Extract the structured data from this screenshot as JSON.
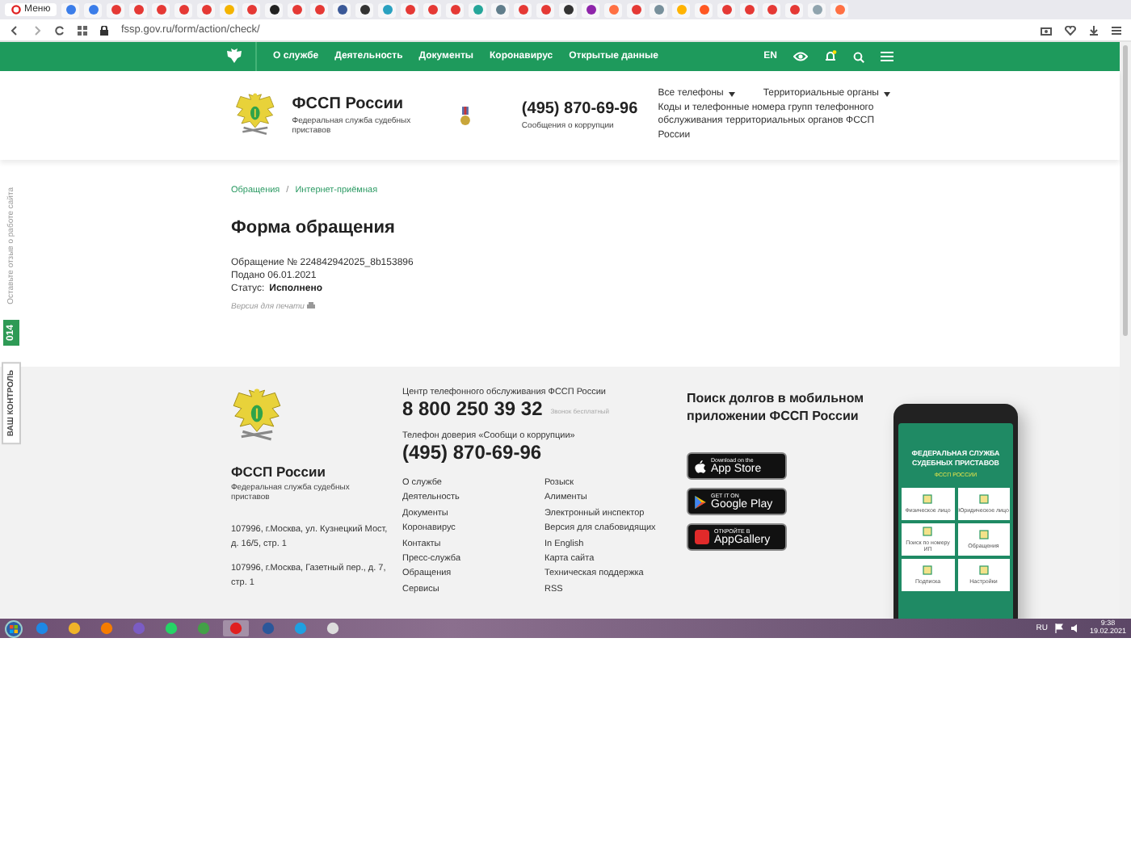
{
  "browser": {
    "menu_label": "Меню",
    "tabs": [
      {
        "color": "#3b7de9"
      },
      {
        "color": "#3b7de9"
      },
      {
        "color": "#e53935"
      },
      {
        "color": "#e53935"
      },
      {
        "color": "#e53935"
      },
      {
        "color": "#e53935"
      },
      {
        "color": "#e53935"
      },
      {
        "color": "#f4b400"
      },
      {
        "color": "#e53935"
      },
      {
        "color": "#222222"
      },
      {
        "color": "#e53935"
      },
      {
        "color": "#e53935"
      },
      {
        "color": "#3b5998"
      },
      {
        "color": "#333333"
      },
      {
        "color": "#2aa1c0"
      },
      {
        "color": "#e53935"
      },
      {
        "color": "#e53935"
      },
      {
        "color": "#e53935"
      },
      {
        "color": "#26a69a"
      },
      {
        "color": "#607d8b"
      },
      {
        "color": "#e53935"
      },
      {
        "color": "#e53935"
      },
      {
        "color": "#333333"
      },
      {
        "color": "#8e24aa"
      },
      {
        "color": "#ff7043"
      },
      {
        "color": "#e53935"
      },
      {
        "color": "#78909c"
      },
      {
        "color": "#ffb300"
      },
      {
        "color": "#ff5722"
      },
      {
        "color": "#e53935"
      },
      {
        "color": "#e53935"
      },
      {
        "color": "#e53935"
      },
      {
        "color": "#e53935"
      },
      {
        "color": "#90a4ae"
      },
      {
        "color": "#ff7043"
      }
    ],
    "url": "fssp.gov.ru/form/action/check/"
  },
  "nav": {
    "items": [
      "О службе",
      "Деятельность",
      "Документы",
      "Коронавирус",
      "Открытые данные"
    ],
    "lang": "EN"
  },
  "header": {
    "org_name": "ФССП России",
    "org_subtitle": "Федеральная служба судебных приставов",
    "phone": "(495) 870-69-96",
    "phone_caption": "Сообщения о коррупции",
    "links": [
      "Все телефоны",
      "Территориальные органы"
    ],
    "note": "Коды и телефонные номера групп телефонного обслуживания территориальных органов ФССП России"
  },
  "breadcrumbs": [
    "Обращения",
    "Интернет-приёмная"
  ],
  "breadcrumb_separator": "/",
  "page_title": "Форма обращения",
  "details": {
    "number": "Обращение № 224842942025_8b153896",
    "submitted": "Подано 06.01.2021",
    "status_label": "Статус:",
    "status_value": "Исполнено"
  },
  "print_link": "Версия для печати",
  "side_tabs": {
    "feedback": "Оставьте отзыв о работе сайта",
    "badge": "014",
    "control": "ВАШ КОНТРОЛЬ"
  },
  "footer": {
    "org_name": "ФССП России",
    "org_subtitle": "Федеральная служба судебных приставов",
    "addresses": [
      "107996, г.Москва, ул. Кузнецкий Мост, д. 16/5, стр. 1",
      "107996, г.Москва, Газетный пер., д. 7, стр. 1"
    ],
    "hotline_label": "Центр телефонного обслуживания ФССП России",
    "hotline": "8 800 250 39 32",
    "hotline_note": "Звонок бесплатный",
    "trust_label": "Телефон доверия «Сообщи о коррупции»",
    "trust_phone": "(495) 870-69-96",
    "links_left": [
      "О службе",
      "Деятельность",
      "Документы",
      "Коронавирус",
      "Контакты",
      "Пресс-служба",
      "Обращения",
      "Сервисы"
    ],
    "links_right": [
      "Розыск",
      "Алименты",
      "Электронный инспектор",
      "Версия для слабовидящих",
      "In English",
      "Карта сайта",
      "Техническая поддержка",
      "RSS"
    ],
    "app_title": "Поиск долгов в мобильном приложении ФССП России",
    "stores": [
      {
        "kind": "apple",
        "small": "Download on the",
        "big": "App Store"
      },
      {
        "kind": "google",
        "small": "GET IT ON",
        "big": "Google Play"
      },
      {
        "kind": "huawei",
        "small": "ОТКРОЙТЕ В",
        "big": "AppGallery"
      }
    ],
    "phone_screen": {
      "title": "ФЕДЕРАЛЬНАЯ СЛУЖБА СУДЕБНЫХ ПРИСТАВОВ",
      "subtitle": "ФССП РОССИИ",
      "tiles": [
        "Физическое лицо",
        "Юридическое лицо",
        "Поиск по номеру ИП",
        "Обращения",
        "Подписка",
        "Настройки"
      ]
    }
  },
  "taskbar": {
    "lang": "RU",
    "time": "9:38",
    "date": "19.02.2021"
  }
}
